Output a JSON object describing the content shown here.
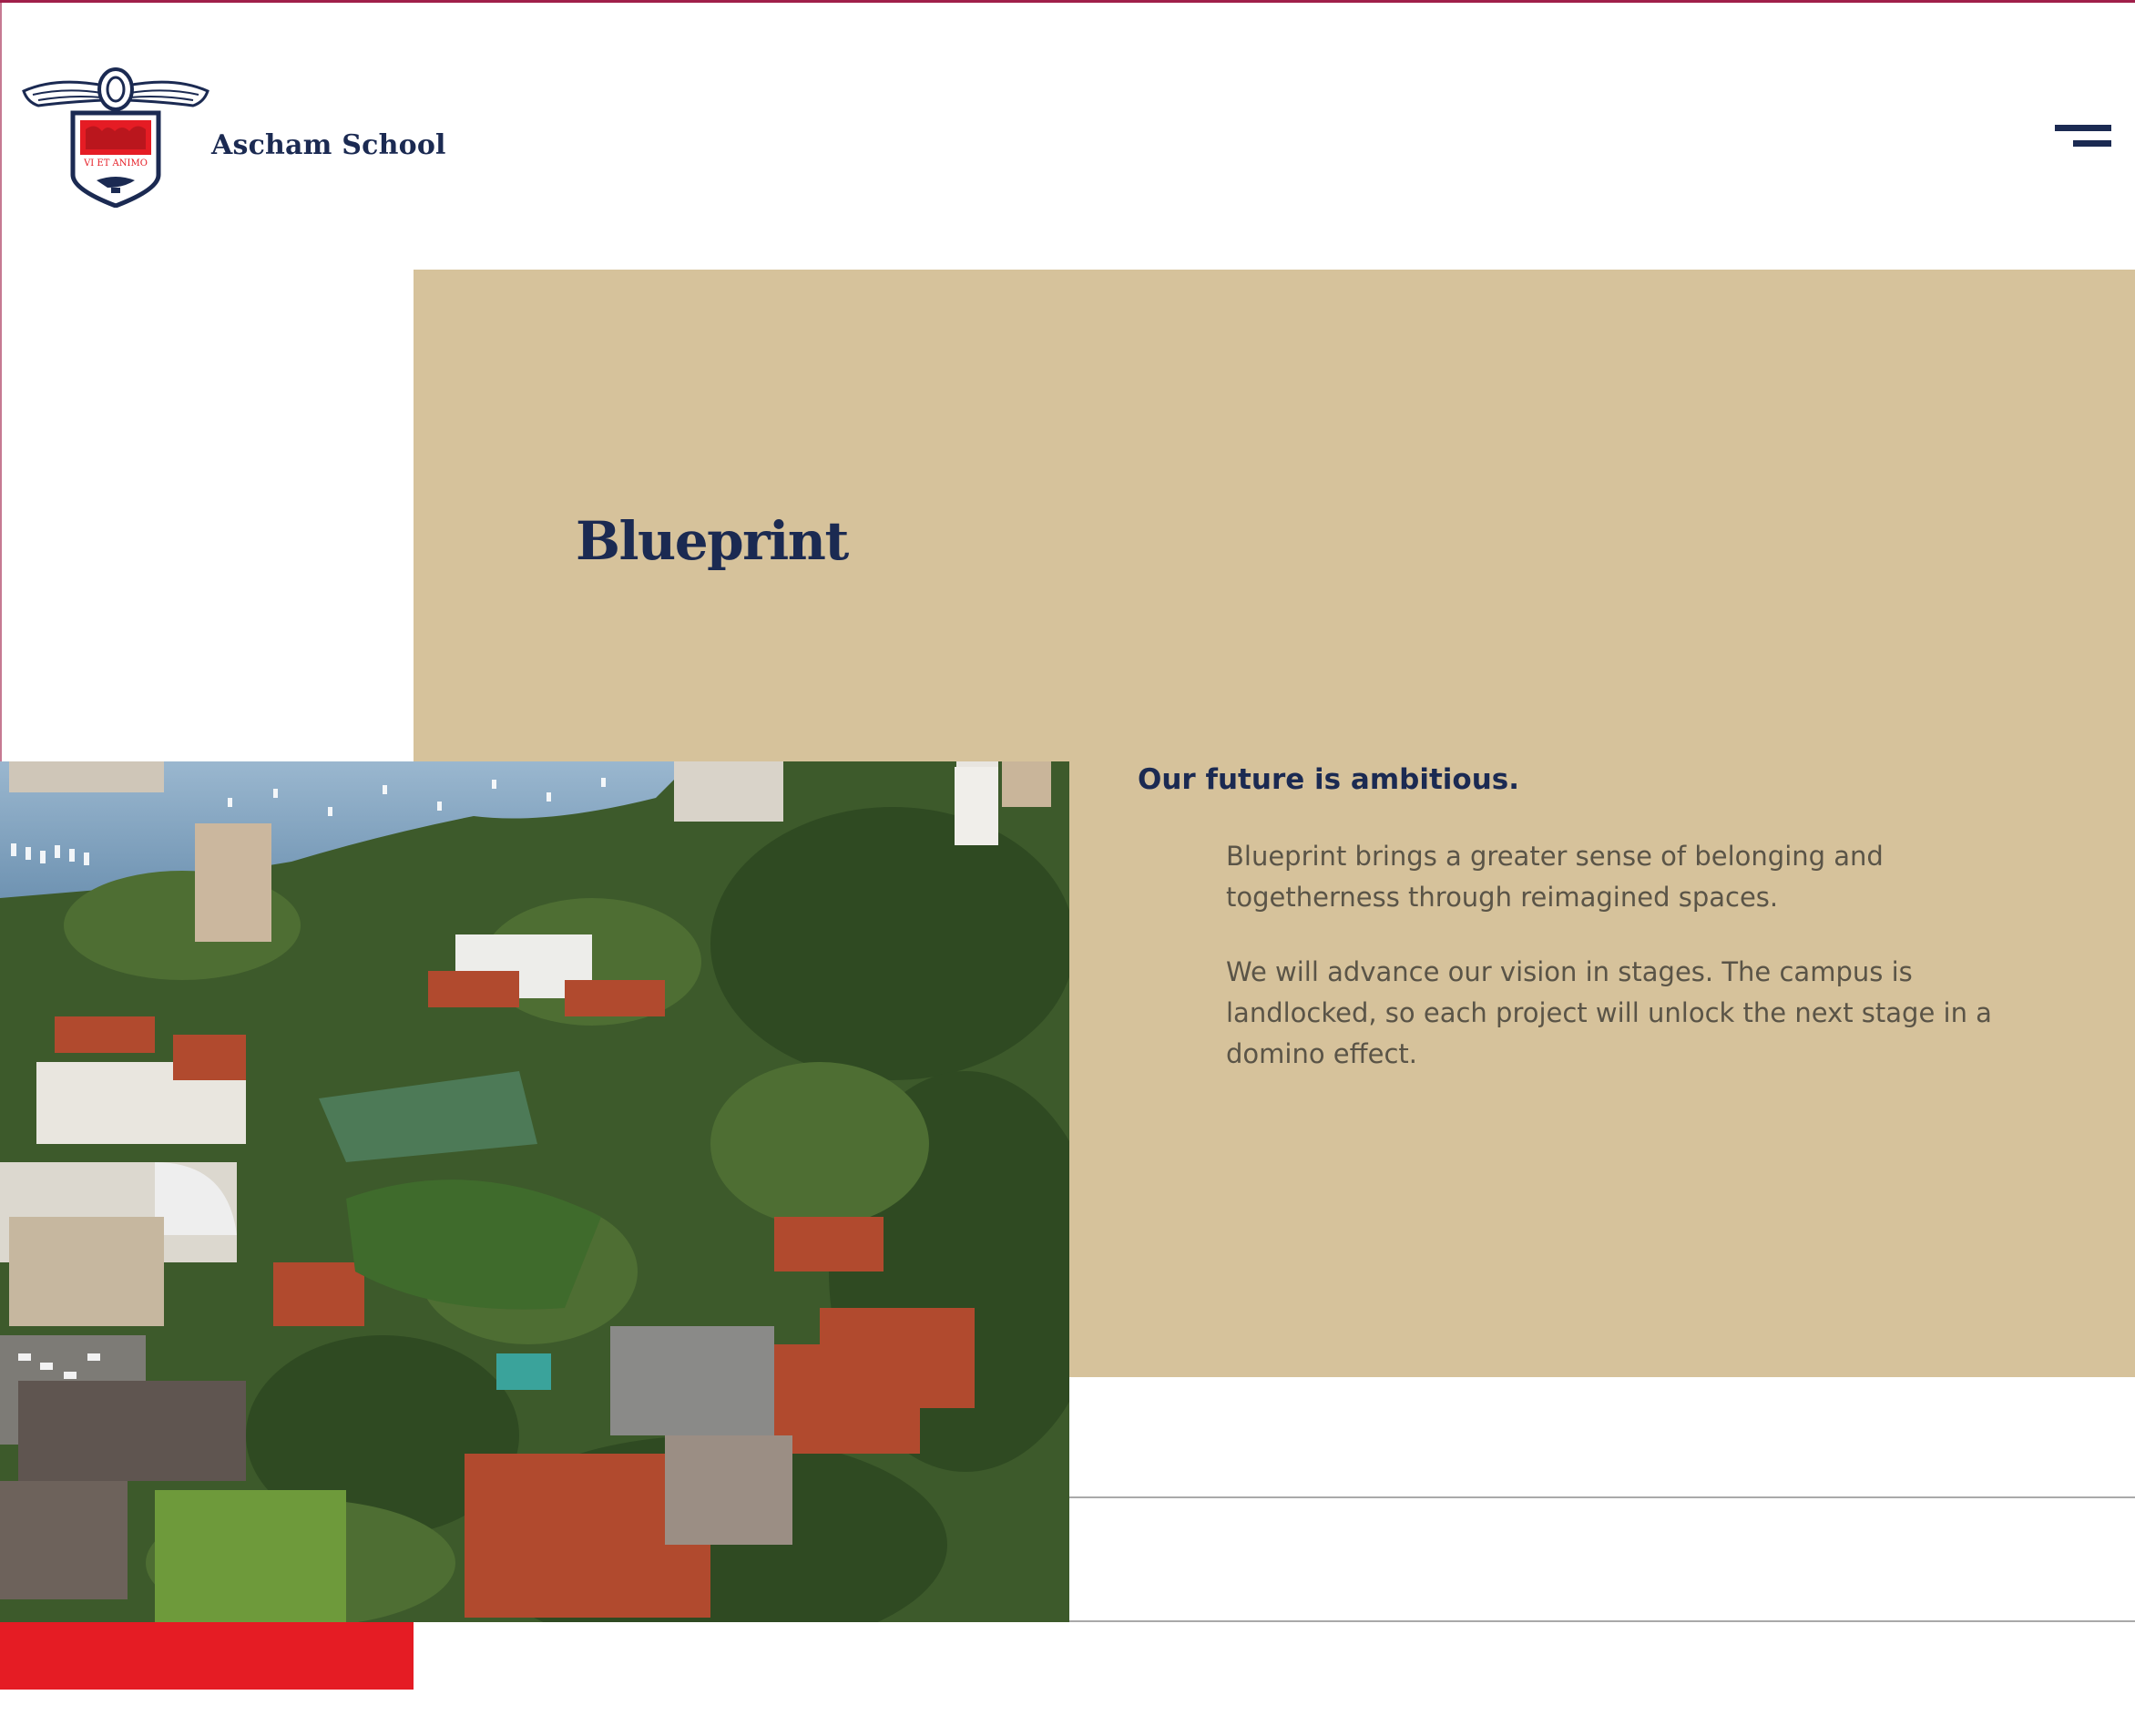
{
  "header": {
    "logo_text": "Ascham School",
    "crest_motto": "VI ET ANIMO",
    "menu_icon": "hamburger-menu-icon"
  },
  "hero": {
    "title": "Blueprint"
  },
  "intro": {
    "heading": "Our future is ambitious.",
    "paragraphs": [
      "Blueprint brings a greater sense of belonging and togetherness through reimagined spaces.",
      "We will advance our vision in stages. The campus is landlocked, so each project will unlock the next stage in a domino effect."
    ]
  },
  "colors": {
    "navy": "#1b2a52",
    "tan": "#d6c29b",
    "red": "#e51c24",
    "body_text": "#5a5447"
  }
}
